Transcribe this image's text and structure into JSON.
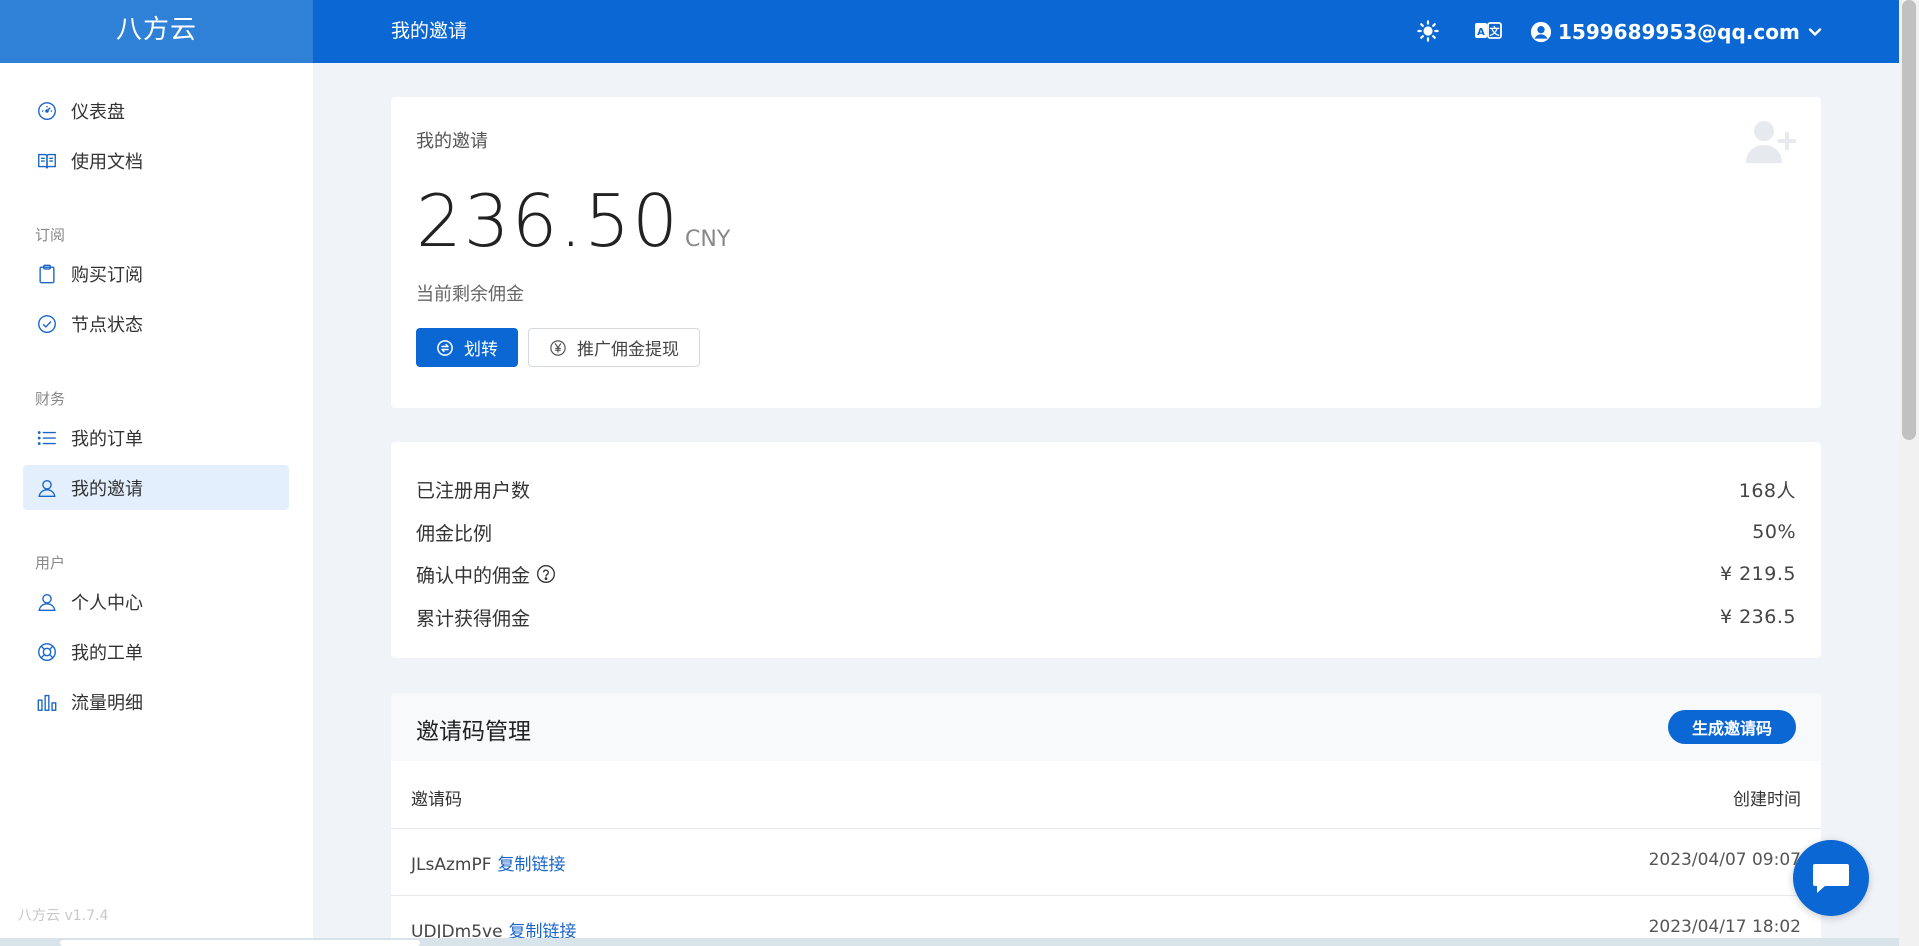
{
  "brand": {
    "name": "八方云"
  },
  "topbar": {
    "page_title": "我的邀请",
    "theme_icon": "sun-icon",
    "language_icon": "translate-icon",
    "user_email": "1599689953@qq.com"
  },
  "sidebar": {
    "items": [
      {
        "label": "仪表盘",
        "icon": "dashboard-icon"
      },
      {
        "label": "使用文档",
        "icon": "book-icon"
      },
      {
        "label": "购买订阅",
        "icon": "clipboard-icon"
      },
      {
        "label": "节点状态",
        "icon": "check-circle-icon"
      },
      {
        "label": "我的订单",
        "icon": "list-icon"
      },
      {
        "label": "我的邀请",
        "icon": "user-icon"
      },
      {
        "label": "个人中心",
        "icon": "user-icon"
      },
      {
        "label": "我的工单",
        "icon": "lifebuoy-icon"
      },
      {
        "label": "流量明细",
        "icon": "bar-chart-icon"
      }
    ],
    "sections": {
      "subscription": "订阅",
      "finance": "财务",
      "user": "用户"
    },
    "version": "八方云 v1.7.4"
  },
  "commission": {
    "title": "我的邀请",
    "amount": "236.50",
    "currency": "CNY",
    "subtitle": "当前剩余佣金",
    "transfer_button": "划转",
    "withdraw_button": "推广佣金提现"
  },
  "stats": [
    {
      "label": "已注册用户数",
      "value": "168人"
    },
    {
      "label": "佣金比例",
      "value": "50%"
    },
    {
      "label": "确认中的佣金",
      "value": "¥ 219.5"
    },
    {
      "label": "累计获得佣金",
      "value": "¥ 236.5"
    }
  ],
  "invite_codes": {
    "title": "邀请码管理",
    "generate_button": "生成邀请码",
    "columns": {
      "code": "邀请码",
      "created": "创建时间"
    },
    "copy_label": "复制链接",
    "rows": [
      {
        "code": "JLsAzmPF",
        "created": "2023/04/07 09:07"
      },
      {
        "code": "UDJDm5ve",
        "created": "2023/04/17 18:02"
      }
    ]
  },
  "colors": {
    "primary": "#0b67d3",
    "brand_bg": "#2f80d7",
    "active_nav": "#e3effc",
    "page_bg": "#f0f3f8"
  }
}
